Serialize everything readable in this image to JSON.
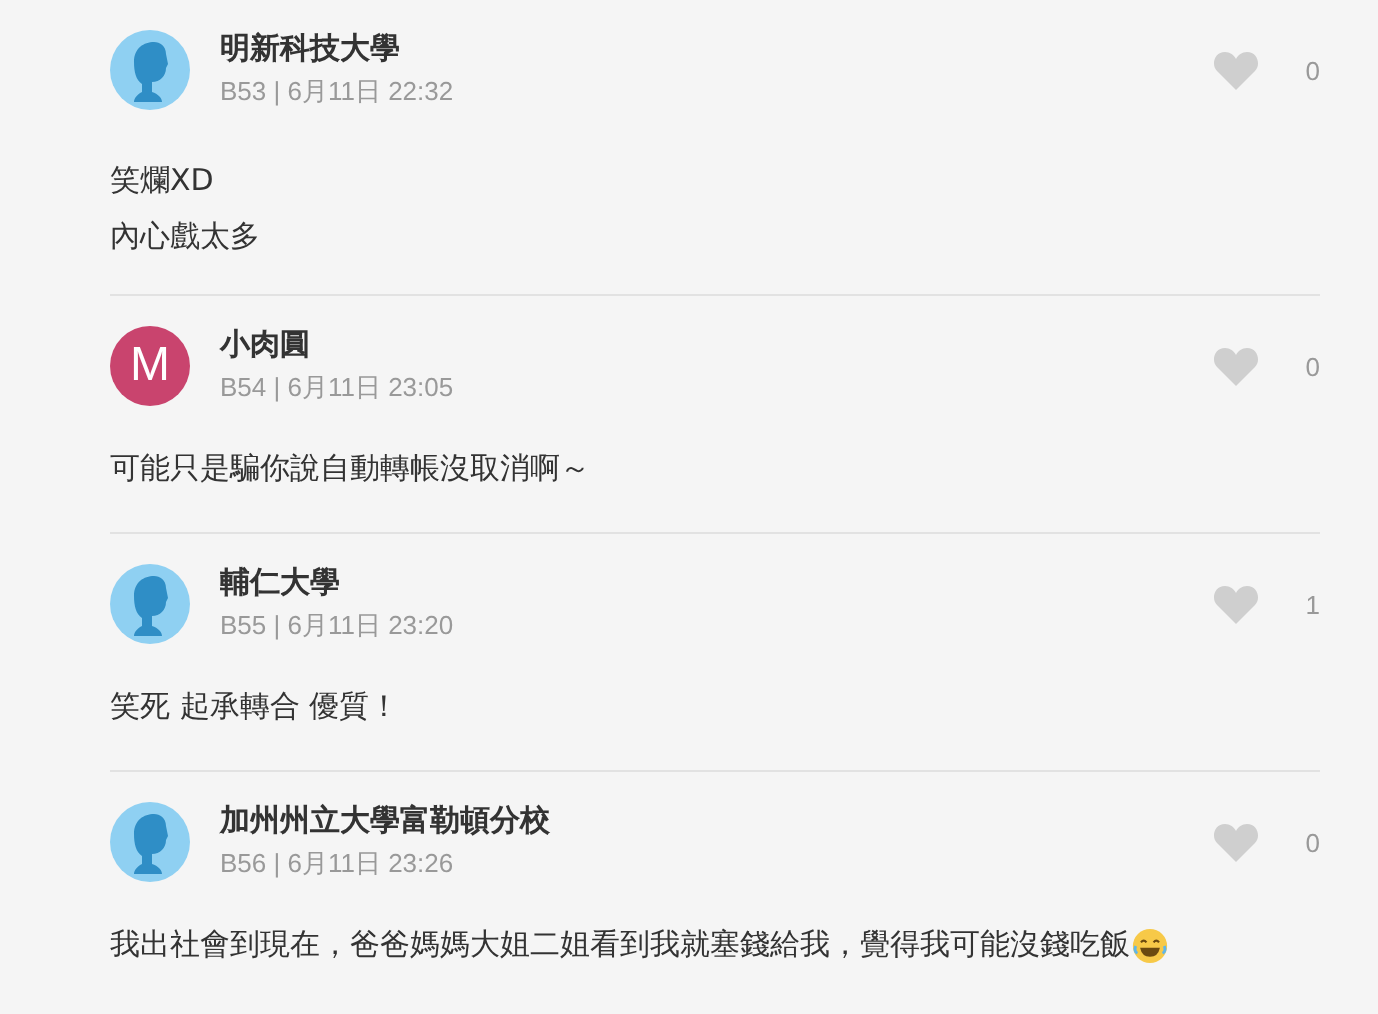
{
  "comments": [
    {
      "avatar": {
        "kind": "silhouette"
      },
      "author": "明新科技大學",
      "meta": "B53 | 6月11日 22:32",
      "likes": "0",
      "lines": [
        "笑爛XD",
        "內心戲太多"
      ],
      "laugh_emoji": false
    },
    {
      "avatar": {
        "kind": "letter",
        "letter": "M",
        "color": "#c9446e"
      },
      "author": "小肉圓",
      "meta": "B54 | 6月11日 23:05",
      "likes": "0",
      "lines": [
        "可能只是騙你說自動轉帳沒取消啊～"
      ],
      "laugh_emoji": false
    },
    {
      "avatar": {
        "kind": "silhouette"
      },
      "author": "輔仁大學",
      "meta": "B55 | 6月11日 23:20",
      "likes": "1",
      "lines": [
        "笑死  起承轉合 優質！"
      ],
      "laugh_emoji": false
    },
    {
      "avatar": {
        "kind": "silhouette"
      },
      "author": "加州州立大學富勒頓分校",
      "meta": "B56 | 6月11日 23:26",
      "likes": "0",
      "lines": [
        "我出社會到現在，爸爸媽媽大姐二姐看到我就塞錢給我，覺得我可能沒錢吃飯"
      ],
      "laugh_emoji": true
    }
  ]
}
